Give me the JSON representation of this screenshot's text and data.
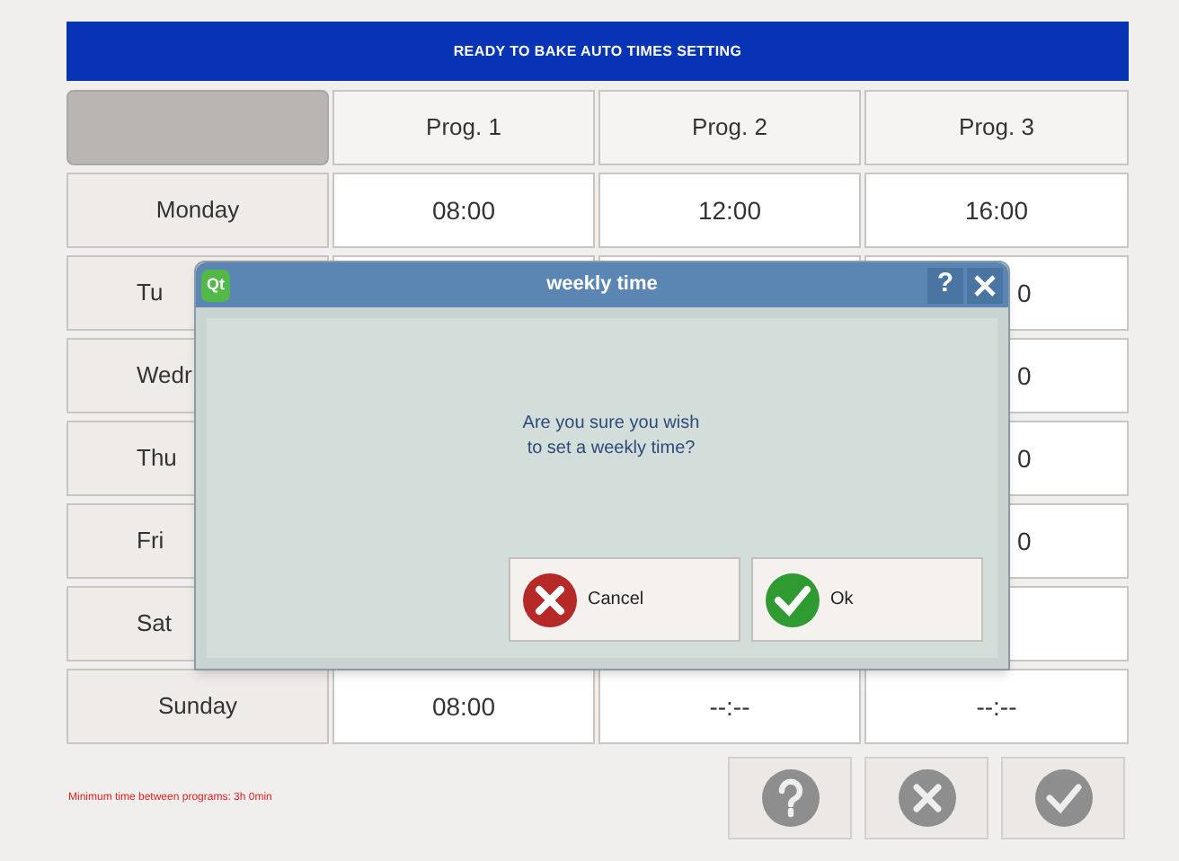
{
  "header": {
    "title": "READY TO BAKE AUTO TIMES SETTING"
  },
  "columns": [
    "Prog. 1",
    "Prog. 2",
    "Prog. 3"
  ],
  "rows": [
    {
      "day": "Monday",
      "covered": false,
      "times": [
        "08:00",
        "12:00",
        "16:00"
      ]
    },
    {
      "day": "Tu",
      "covered": true,
      "tail": "0"
    },
    {
      "day": "Wedr",
      "covered": true,
      "tail": "0"
    },
    {
      "day": "Thu",
      "covered": true,
      "tail": "0"
    },
    {
      "day": "Fri",
      "covered": true,
      "tail": "0"
    },
    {
      "day": "Sat",
      "covered": true
    },
    {
      "day": "Sunday",
      "covered": false,
      "times": [
        "08:00",
        "--:--",
        "--:--"
      ]
    }
  ],
  "footer": {
    "note": "Minimum time between programs: 3h 0min"
  },
  "dialog": {
    "logo": "Qt",
    "title": "weekly time",
    "help": "?",
    "message": "Are you sure you wish\nto set a weekly time?",
    "buttons": [
      {
        "label": "Cancel",
        "kind": "cancel"
      },
      {
        "label": "Ok",
        "kind": "ok"
      }
    ]
  }
}
